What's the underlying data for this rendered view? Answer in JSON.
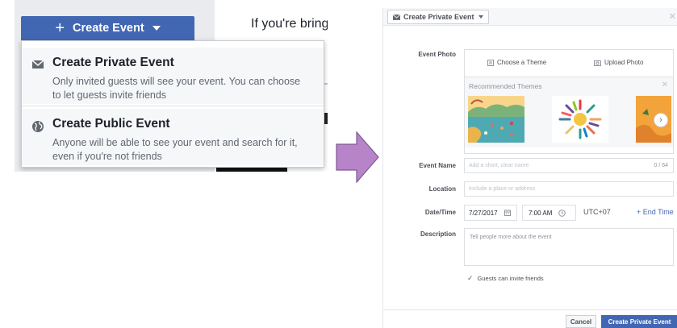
{
  "left_panel": {
    "create_event_button": "Create Event",
    "background_text": "If you're bring",
    "menu": [
      {
        "title": "Create Private Event",
        "description": "Only invited guests will see your event. You can choose to let guests invite friends",
        "icon": "envelope-icon"
      },
      {
        "title": "Create Public Event",
        "description": "Anyone will be able to see your event and search for it, even if you're not friends",
        "icon": "globe-icon"
      }
    ]
  },
  "arrow": {
    "color": "#b784c9",
    "icon": "right-arrow-icon"
  },
  "dialog": {
    "title": "Create Private Event",
    "photo": {
      "label": "Event Photo",
      "choose_theme": "Choose a Theme",
      "upload_photo": "Upload Photo",
      "recommended_label": "Recommended Themes"
    },
    "event_name": {
      "label": "Event Name",
      "placeholder": "Add a short, clear name",
      "counter": "0 / 64"
    },
    "location": {
      "label": "Location",
      "placeholder": "Include a place or address"
    },
    "datetime": {
      "label": "Date/Time",
      "date": "7/27/2017",
      "time": "7:00 AM",
      "timezone": "UTC+07",
      "end_time_link": "+ End Time"
    },
    "description": {
      "label": "Description",
      "placeholder": "Tell people more about the event"
    },
    "guests_invite": {
      "label": "Guests can invite friends",
      "checked": true
    },
    "footer": {
      "cancel": "Cancel",
      "submit": "Create Private Event"
    }
  },
  "colors": {
    "brand_blue": "#4267b2",
    "panel_gray": "#e9ebee"
  }
}
